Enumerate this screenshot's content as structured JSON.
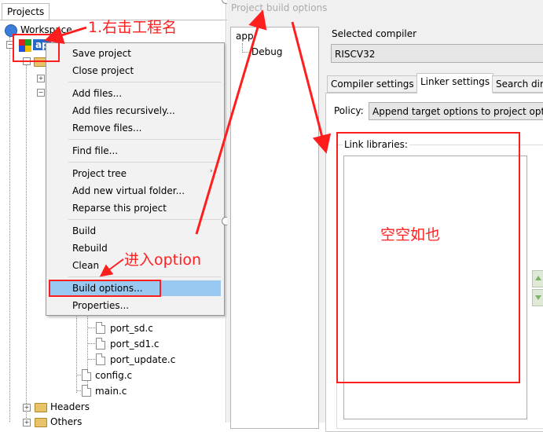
{
  "left_panel": {
    "tab_label": "Projects",
    "workspace_label": "Workspace",
    "project_label": "ap",
    "files": [
      "port_sd.c",
      "port_sd1.c",
      "port_update.c",
      "config.c",
      "main.c"
    ],
    "folders": [
      "Headers",
      "Others"
    ]
  },
  "context_menu": {
    "groups": [
      [
        "Save project",
        "Close project"
      ],
      [
        "Add files...",
        "Add files recursively...",
        "Remove files..."
      ],
      [
        "Find file..."
      ],
      [
        "Project tree",
        "Add new virtual folder...",
        "Reparse this project"
      ],
      [
        "Build",
        "Rebuild",
        "Clean"
      ],
      [
        "Build options...",
        "Properties..."
      ]
    ],
    "highlighted": "Build options...",
    "submenu_arrow": "›"
  },
  "dialog": {
    "title": "Project build options",
    "targets": [
      "app",
      "Debug"
    ],
    "selected_compiler_label": "Selected compiler",
    "compiler_value": "RISCV32",
    "tabs": [
      "Compiler settings",
      "Linker settings",
      "Search dir"
    ],
    "active_tab": "Linker settings",
    "policy_label": "Policy:",
    "policy_value": "Append target options to project opt",
    "link_libraries_label": "Link libraries:",
    "link_libraries": []
  },
  "annotations": {
    "step1": "1.右击工程名",
    "step2": "进入option",
    "empty": "空空如也"
  },
  "colors": {
    "annotation": "#ff1e1e",
    "menu_highlight": "#99c9f1"
  }
}
